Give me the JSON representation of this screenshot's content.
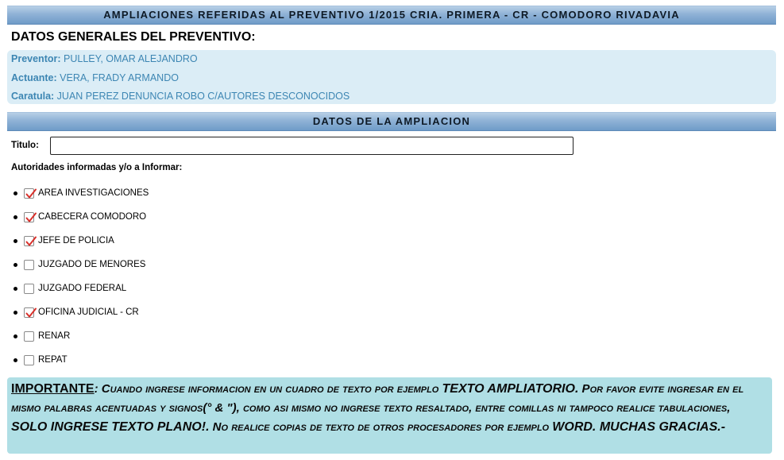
{
  "header": {
    "title": "AMPLIACIONES REFERIDAS AL PREVENTIVO 1/2015 CRIA. PRIMERA - CR - COMODORO RIVADAVIA"
  },
  "general": {
    "section_title": "DATOS GENERALES DEL PREVENTIVO:",
    "fields": [
      {
        "label": "Preventor:",
        "value": "PULLEY, OMAR ALEJANDRO"
      },
      {
        "label": "Actuante:",
        "value": "VERA, FRADY ARMANDO"
      },
      {
        "label": "Caratula:",
        "value": "JUAN PEREZ DENUNCIA ROBO C/AUTORES DESCONOCIDOS"
      }
    ]
  },
  "ampliacion": {
    "section_title": "DATOS DE LA AMPLIACION",
    "titulo_label": "Titulo:",
    "titulo_value": "",
    "autoridades_label": "Autoridades informadas y/o a Informar:",
    "autoridades": [
      {
        "label": "AREA INVESTIGACIONES",
        "checked": true
      },
      {
        "label": "CABECERA COMODORO",
        "checked": true
      },
      {
        "label": "JEFE DE POLICIA",
        "checked": true
      },
      {
        "label": "JUZGADO DE MENORES",
        "checked": false
      },
      {
        "label": "JUZGADO FEDERAL",
        "checked": false
      },
      {
        "label": "OFICINA JUDICIAL - CR",
        "checked": true
      },
      {
        "label": "RENAR",
        "checked": false
      },
      {
        "label": "REPAT",
        "checked": false
      }
    ]
  },
  "notice": {
    "important": "IMPORTANTE",
    "p1": ": Cuando ingrese informacion en un cuadro de texto por ejemplo ",
    "c1": "TEXTO AMPLIATORIO.",
    "p2": " Por favor evite ingresar en el mismo palabras acentuadas y signos(° & \"), como asi mismo no ingrese texto resaltado, entre comillas ni tampoco realice tabulaciones, ",
    "c2": "SOLO INGRESE TEXTO PLANO!.",
    "p3": " No realice copias de texto de otros procesadores por ejemplo ",
    "c3": "WORD. MUCHAS GRACIAS.-"
  },
  "colors": {
    "info_text": "#3d86b3",
    "info_bg": "#dbedf6",
    "notice_bg": "#b0dfe5",
    "check_mark": "#d9302b"
  }
}
